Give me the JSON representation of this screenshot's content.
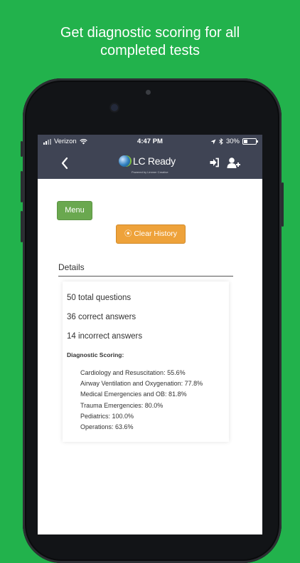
{
  "headline": {
    "line1": "Get diagnostic scoring for all",
    "line2": "completed tests"
  },
  "status_bar": {
    "carrier": "Verizon",
    "time": "4:47 PM",
    "battery": "30%",
    "battery_level": 0.3,
    "icons": [
      "signal-icon",
      "wifi-icon",
      "location-icon",
      "bluetooth-icon",
      "battery-icon"
    ]
  },
  "nav_bar": {
    "logo_text": "LC Ready",
    "logo_subtitle": "Powered by Limmer Creative",
    "icons": [
      "back-icon",
      "login-icon",
      "add-user-icon"
    ]
  },
  "buttons": {
    "menu": "Menu",
    "clear_history": "⦿ Clear History"
  },
  "details": {
    "title": "Details",
    "total_questions": "50 total questions",
    "correct_answers": "36 correct answers",
    "incorrect_answers": "14 incorrect answers",
    "diagnostic_title": "Diagnostic Scoring:",
    "scores": [
      "Cardiology and Resuscitation: 55.6%",
      "Airway Ventilation and Oxygenation: 77.8%",
      "Medical Emergencies and OB: 81.8%",
      "Trauma Emergencies: 80.0%",
      "Pediatrics: 100.0%",
      "Operations: 63.6%"
    ]
  },
  "colors": {
    "background": "#22b24c",
    "nav": "#3f4454",
    "menu_button": "#6aa84f",
    "clear_button": "#eea23a"
  }
}
